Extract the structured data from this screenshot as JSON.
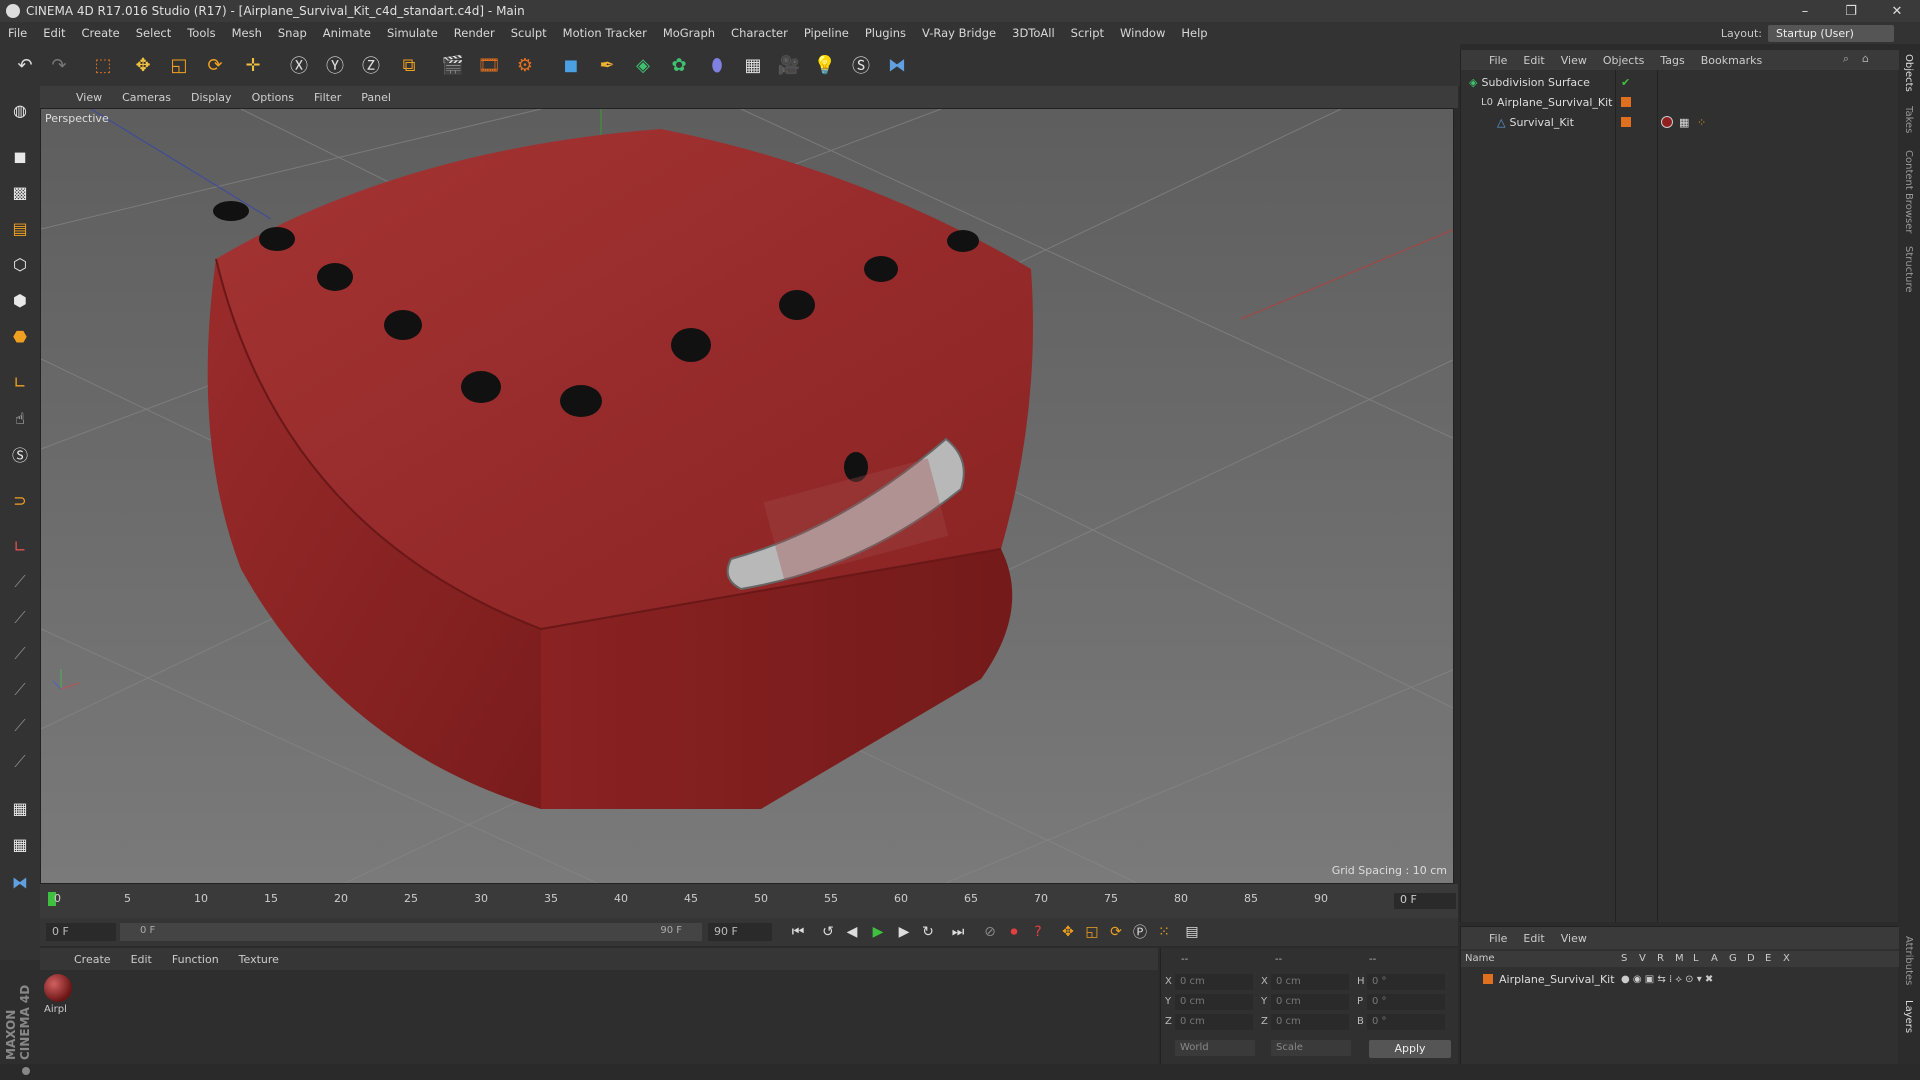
{
  "window": {
    "title": "CINEMA 4D R17.016 Studio (R17) - [Airplane_Survival_Kit_c4d_standart.c4d] - Main",
    "minimize": "–",
    "restore": "❐",
    "close": "✕"
  },
  "menu": [
    "File",
    "Edit",
    "Create",
    "Select",
    "Tools",
    "Mesh",
    "Snap",
    "Animate",
    "Simulate",
    "Render",
    "Sculpt",
    "Motion Tracker",
    "MoGraph",
    "Character",
    "Pipeline",
    "Plugins",
    "V-Ray Bridge",
    "3DToAll",
    "Script",
    "Window",
    "Help"
  ],
  "layout": {
    "label": "Layout:",
    "value": "Startup (User)"
  },
  "viewport": {
    "menu": [
      "View",
      "Cameras",
      "Display",
      "Options",
      "Filter",
      "Panel"
    ],
    "label": "Perspective",
    "grid_spacing": "Grid Spacing : 10 cm"
  },
  "timeline": {
    "ticks": [
      "0",
      "5",
      "10",
      "15",
      "20",
      "25",
      "30",
      "35",
      "40",
      "45",
      "50",
      "55",
      "60",
      "65",
      "70",
      "75",
      "80",
      "85",
      "90"
    ],
    "current_frame": "0 F",
    "start_field": "0 F",
    "slider_start": "0 F",
    "slider_end": "90 F",
    "end_field": "90 F"
  },
  "material_panel": {
    "menu": [
      "Create",
      "Edit",
      "Function",
      "Texture"
    ],
    "material_name": "Airpl"
  },
  "coords": {
    "header": [
      "--",
      "--",
      "--"
    ],
    "rows": [
      {
        "a": "X",
        "v1": "0 cm",
        "b": "X",
        "v2": "0 cm",
        "c": "H",
        "v3": "0 °"
      },
      {
        "a": "Y",
        "v1": "0 cm",
        "b": "Y",
        "v2": "0 cm",
        "c": "P",
        "v3": "0 °"
      },
      {
        "a": "Z",
        "v1": "0 cm",
        "b": "Z",
        "v2": "0 cm",
        "c": "B",
        "v3": "0 °"
      }
    ],
    "world": "World",
    "scale": "Scale",
    "apply": "Apply"
  },
  "objects_panel": {
    "menu": [
      "File",
      "Edit",
      "View",
      "Objects",
      "Tags",
      "Bookmarks"
    ],
    "items": [
      {
        "name": "Subdivision Surface",
        "indent": 0
      },
      {
        "name": "Airplane_Survival_Kit",
        "indent": 1
      },
      {
        "name": "Survival_Kit",
        "indent": 2
      }
    ]
  },
  "attributes_panel": {
    "menu": [
      "File",
      "Edit",
      "View"
    ],
    "columns": [
      "Name",
      "S",
      "V",
      "R",
      "M",
      "L",
      "A",
      "G",
      "D",
      "E",
      "X"
    ],
    "row": "Airplane_Survival_Kit"
  },
  "side_tabs": [
    "Objects",
    "Takes",
    "Content Browser",
    "Structure",
    "Attributes",
    "Layers"
  ],
  "brand": "MAXON CINEMA 4D",
  "colors": {
    "bag_red": "#8e2424",
    "accent_orange": "#e07020"
  }
}
